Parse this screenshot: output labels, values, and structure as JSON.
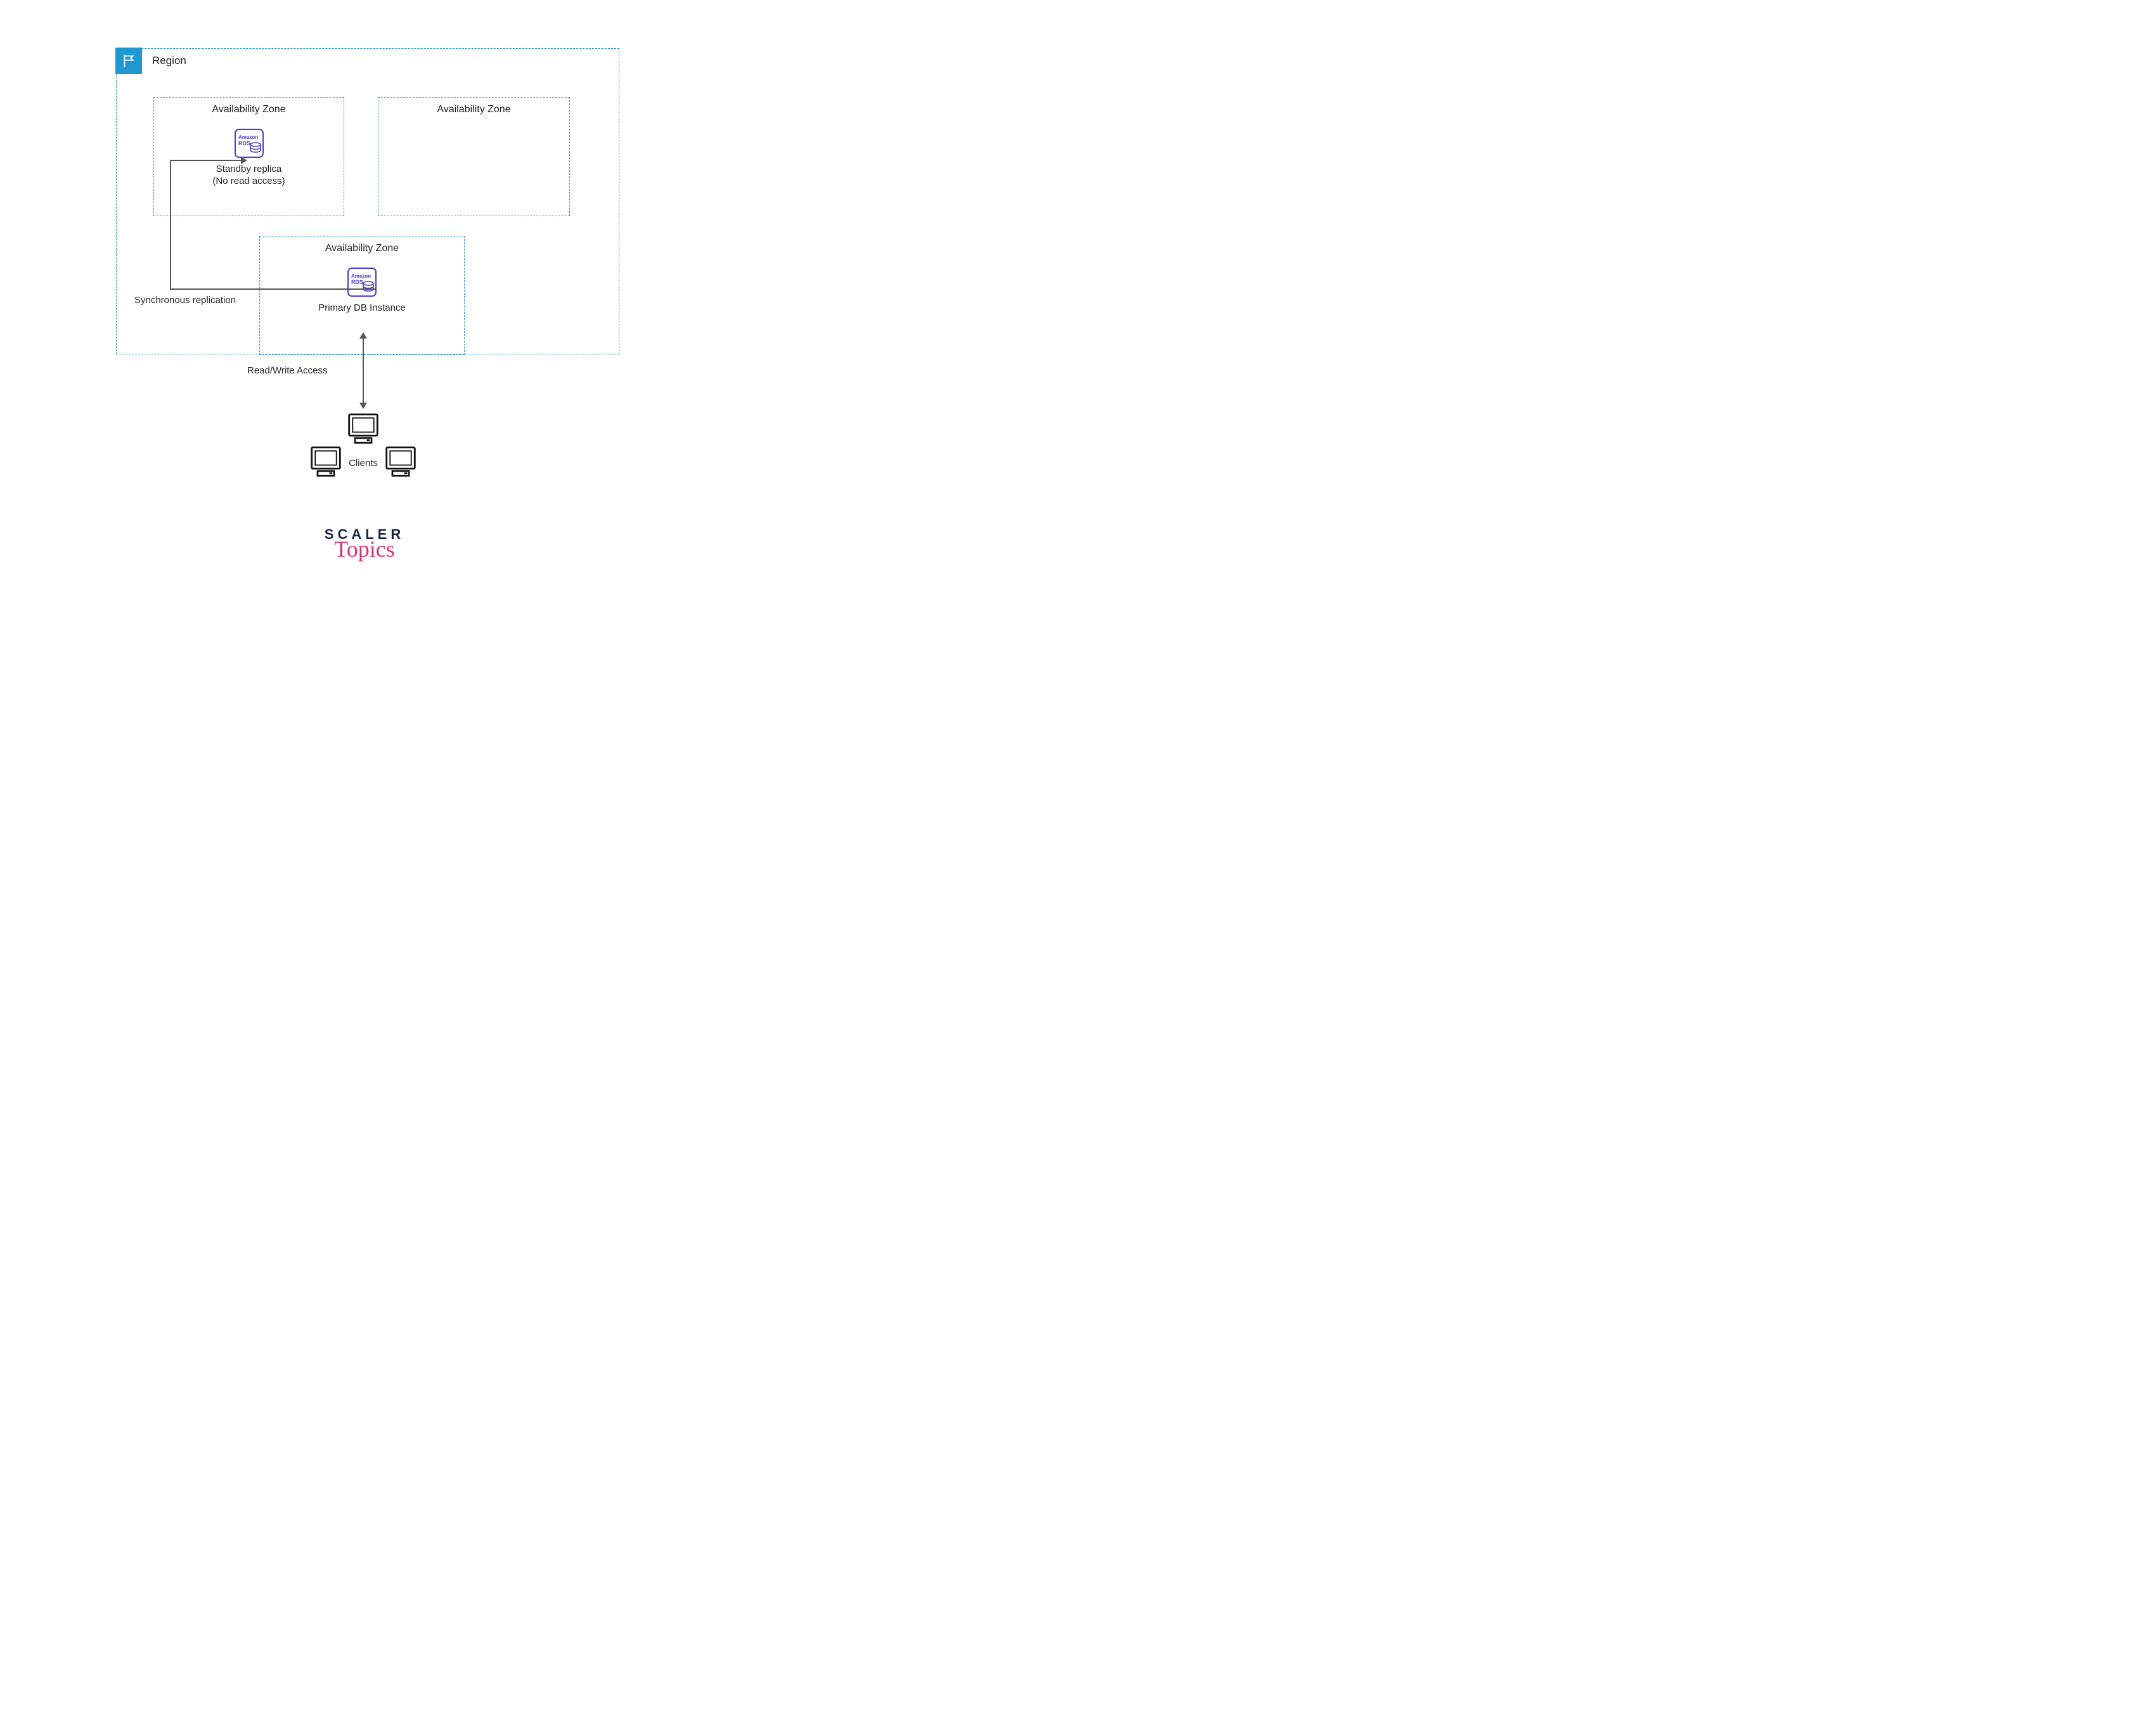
{
  "region": {
    "label": "Region"
  },
  "az": {
    "left": {
      "label": "Availability Zone"
    },
    "right": {
      "label": "Availability Zone"
    },
    "bottom": {
      "label": "Availability Zone"
    }
  },
  "standby": {
    "icon_text_top": "Amazon",
    "icon_text_bottom": "RDS",
    "caption_line1": "Standby replica",
    "caption_line2": "(No read access)"
  },
  "primary": {
    "icon_text_top": "Amazon",
    "icon_text_bottom": "RDS",
    "caption": "Primary DB Instance"
  },
  "labels": {
    "sync": "Synchronous replication",
    "rw": "Read/Write Access",
    "clients": "Clients"
  },
  "brand": {
    "line1": "SCALER",
    "line2": "Topics"
  }
}
